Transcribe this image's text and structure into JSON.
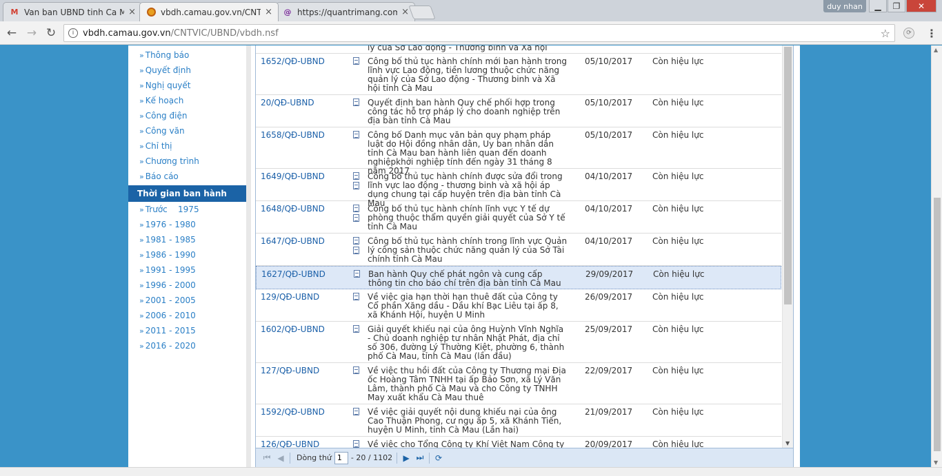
{
  "browser": {
    "tabs": [
      {
        "title": "Van ban UBND tinh Ca M",
        "icon": "gmail-icon"
      },
      {
        "title": "vbdh.camau.gov.vn/CNTV",
        "icon": "site-icon"
      },
      {
        "title": "https://quantrimang.com",
        "icon": "quantrimang-icon"
      }
    ],
    "close_glyph": "×",
    "user": "duy nhan",
    "url_host": "vbdh.camau.gov.vn",
    "url_path": "/CNTVIC/UBND/vbdh.nsf"
  },
  "sidebar": {
    "type_items": [
      "Thông báo",
      "Quyết định",
      "Nghị quyết",
      "Kế hoạch",
      "Công điện",
      "Công văn",
      "Chỉ thị",
      "Chương trình",
      "Báo cáo"
    ],
    "time_heading": "Thời gian ban hành",
    "time_items": [
      "Trước    1975",
      "1976 - 1980",
      "1981 - 1985",
      "1986 - 1990",
      "1991 - 1995",
      "1996 - 2000",
      "2001 - 2005",
      "2006 - 2010",
      "2011 - 2015",
      "2016 - 2020"
    ]
  },
  "documents": {
    "top_partial": "lý của Sở Lao động - Thương binh và Xã hội",
    "rows": [
      {
        "number": "1652/QĐ-UBND",
        "subject": "Công bố thủ tục hành chính mới ban hành trong lĩnh vực Lao động, tiền lương thuộc chức năng quản lý của Sở Lao động - Thương binh và Xã hội tỉnh Cà Mau",
        "date": "05/10/2017",
        "status": "Còn hiệu lực"
      },
      {
        "number": "20/QĐ-UBND",
        "subject": "Quyết định ban hành Quy chế phối hợp trong công tác hỗ trợ pháp lý cho doanh nghiệp trên địa bàn tỉnh Cà Mau",
        "date": "05/10/2017",
        "status": "Còn hiệu lực"
      },
      {
        "number": "1658/QĐ-UBND",
        "subject": "Công bố Danh mục văn bản quy phạm pháp luật do Hội đồng nhân dân, Uy ban nhân dân tỉnh Cà Mau ban hành liên quan đến doanh nghiệpkhởi nghiệp tính đến ngày 31 tháng 8 năm 2017",
        "date": "05/10/2017",
        "status": "Còn hiệu lực"
      },
      {
        "number": "1649/QĐ-UBND",
        "subject": "Công bố thủ tục hành chính được sửa đổi trong lĩnh vực lao động - thương binh và xã hội áp dụng chung tại cấp huyện trên địa bàn tỉnh Cà Mau",
        "date": "04/10/2017",
        "status": "Còn hiệu lực"
      },
      {
        "number": "1648/QĐ-UBND",
        "subject": "Công bố thủ tục hành chính lĩnh vực Y tế dự phòng thuộc thẩm quyền giải quyết của Sở Y tế tỉnh Cà Mau",
        "date": "04/10/2017",
        "status": "Còn hiệu lực"
      },
      {
        "number": "1647/QĐ-UBND",
        "subject": "Công bố thủ tục hành chính trong lĩnh vực Quản lý công sản thuộc chức năng quản lý của Sở Tài chính tỉnh Cà Mau",
        "date": "04/10/2017",
        "status": "Còn hiệu lực"
      },
      {
        "number": "1627/QĐ-UBND",
        "subject": "Ban hành Quy chế phát ngôn và cung cấp thông tin cho báo chí trên địa bàn tỉnh Cà Mau",
        "date": "29/09/2017",
        "status": "Còn hiệu lực"
      },
      {
        "number": "129/QĐ-UBND",
        "subject": "Về việc gia hạn thời hạn thuê đất của Công ty Cổ phần Xăng dầu - Dầu khí Bạc Liêu tại ấp 8, xã Khánh Hội, huyện U Minh",
        "date": "26/09/2017",
        "status": "Còn hiệu lực"
      },
      {
        "number": "1602/QĐ-UBND",
        "subject": "Giải quyết khiếu nại của ông Huỳnh Vĩnh Nghĩa - Chủ doanh nghiệp tư nhân Nhật Phát, địa chỉ số 306, đường Lý Thường Kiệt, phường 6, thành phố Cà Mau, tỉnh Cà Mau (lần đầu)",
        "date": "25/09/2017",
        "status": "Còn hiệu lực"
      },
      {
        "number": "127/QĐ-UBND",
        "subject": "Về việc thu hồi đất của Công ty Thương mại Địa ốc Hoàng Tâm TNHH tại ấp Bảo Sơn, xã Lý Văn Lâm, thành phố Cà Mau và cho Công ty TNHH May xuất khẩu Cà Mau thuê",
        "date": "22/09/2017",
        "status": "Còn hiệu lực"
      },
      {
        "number": "1592/QĐ-UBND",
        "subject": "Về việc giải quyết nội dung khiếu nại của ông Cao Thuận Phong, cư ngụ ấp 5, xã Khánh Tiến, huyện U Minh, tỉnh Cà Mau (Lần hai)",
        "date": "21/09/2017",
        "status": "Còn hiệu lực"
      },
      {
        "number": "126/QĐ-UBND",
        "subject": "Về việc cho Tổng Công ty Khí Việt Nam Công ty Cổ",
        "date": "20/09/2017",
        "status": "Còn hiệu lực"
      }
    ]
  },
  "pager": {
    "label": "Dòng thứ",
    "current": "1",
    "range_text": "- 20 / 1102"
  }
}
